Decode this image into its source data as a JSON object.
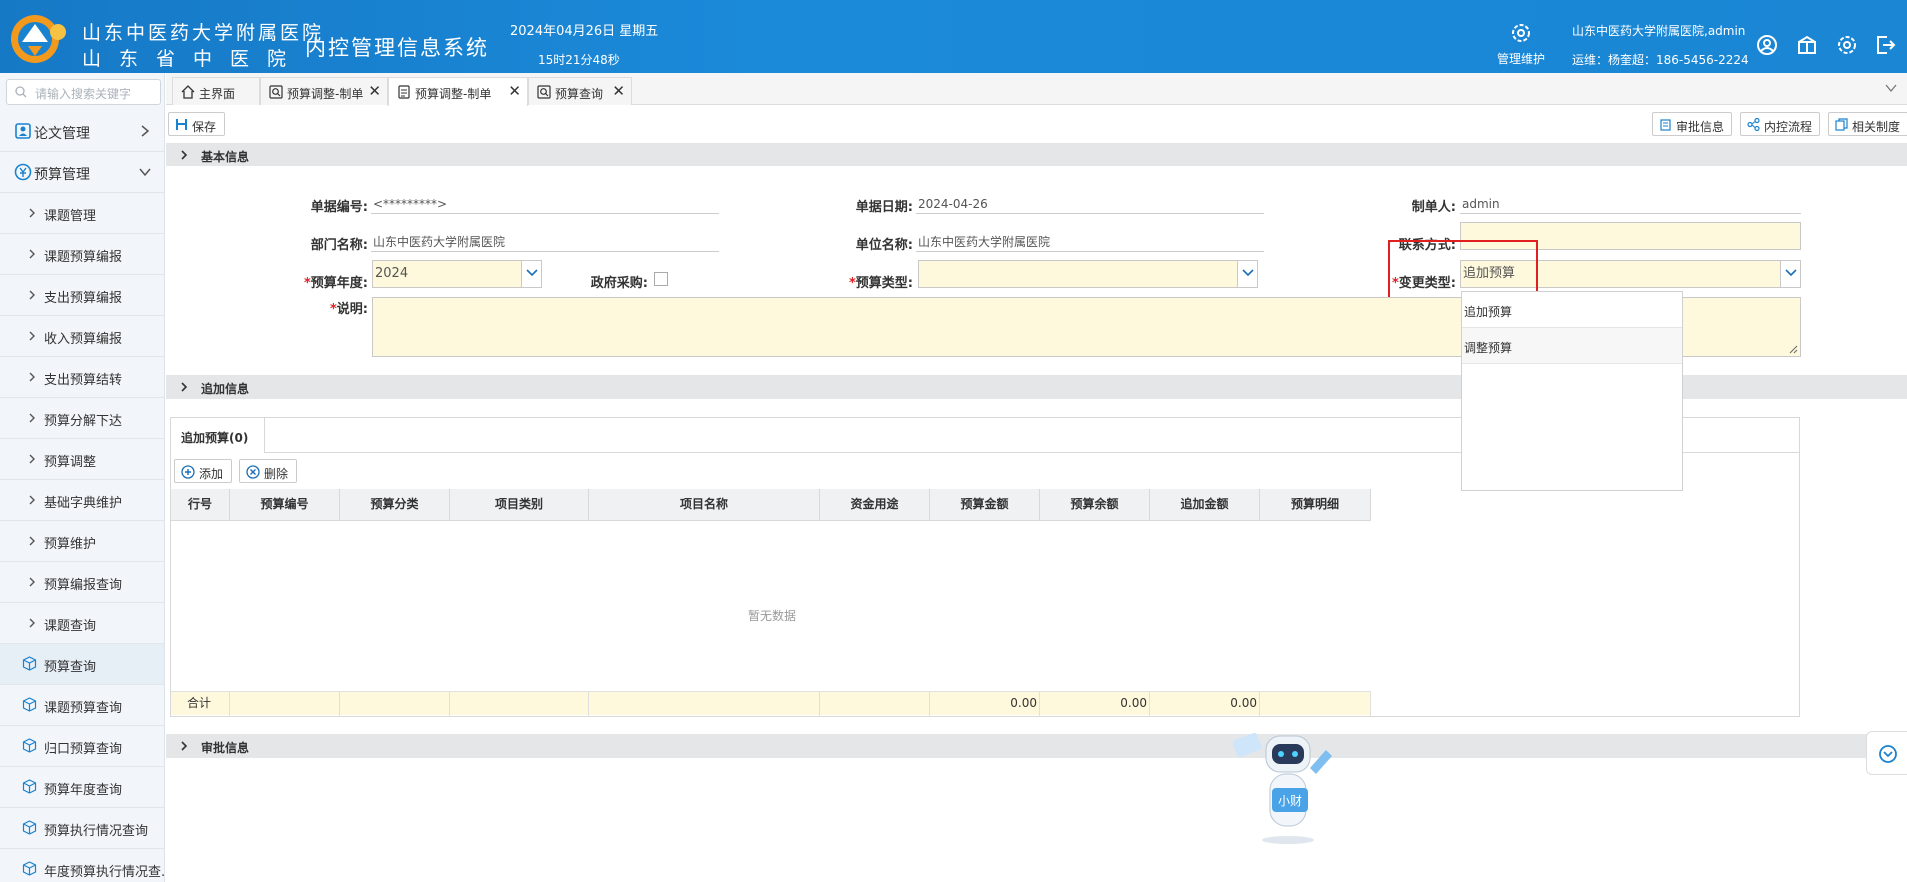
{
  "header": {
    "hospital_line1": "山东中医药大学附属医院",
    "hospital_line2": "山东省中医院",
    "system_name": "内控管理信息系统",
    "date": "2024年04月26日 星期五",
    "time": "15时21分48秒",
    "manage_label": "管理维护",
    "user": "山东中医药大学附属医院,admin",
    "ops": "运维：杨奎超：186-5456-2224",
    "icons": [
      "user-circle-icon",
      "gift-icon",
      "settings-icon",
      "logout-icon"
    ]
  },
  "sidebar": {
    "search_placeholder": "请输入搜索关键字",
    "items": [
      {
        "label": "论文管理",
        "kind": "top",
        "expanded": false
      },
      {
        "label": "预算管理",
        "kind": "top",
        "expanded": true
      },
      {
        "label": "课题管理",
        "kind": "sub"
      },
      {
        "label": "课题预算编报",
        "kind": "sub"
      },
      {
        "label": "支出预算编报",
        "kind": "sub"
      },
      {
        "label": "收入预算编报",
        "kind": "sub"
      },
      {
        "label": "支出预算结转",
        "kind": "sub"
      },
      {
        "label": "预算分解下达",
        "kind": "sub"
      },
      {
        "label": "预算调整",
        "kind": "sub"
      },
      {
        "label": "基础字典维护",
        "kind": "sub"
      },
      {
        "label": "预算维护",
        "kind": "sub"
      },
      {
        "label": "预算编报查询",
        "kind": "sub"
      },
      {
        "label": "课题查询",
        "kind": "sub"
      },
      {
        "label": "预算查询",
        "kind": "query",
        "active": true
      },
      {
        "label": "课题预算查询",
        "kind": "query"
      },
      {
        "label": "归口预算查询",
        "kind": "query"
      },
      {
        "label": "预算年度查询",
        "kind": "query"
      },
      {
        "label": "预算执行情况查询",
        "kind": "query"
      },
      {
        "label": "年度预算执行情况查...",
        "kind": "query"
      }
    ]
  },
  "tabs": [
    {
      "label": "主界面",
      "closable": false,
      "active": false
    },
    {
      "label": "预算调整-制单",
      "closable": true,
      "active": false
    },
    {
      "label": "预算调整-制单",
      "closable": true,
      "active": true
    },
    {
      "label": "预算查询",
      "closable": true,
      "active": false
    }
  ],
  "toolbar": {
    "save": "保存",
    "approval_info": "审批信息",
    "control_flow": "内控流程",
    "related_rules": "相关制度"
  },
  "sections": {
    "basic": "基本信息",
    "additional": "追加信息",
    "approval": "审批信息"
  },
  "form": {
    "doc_no_label": "单据编号:",
    "doc_no": "<*********>",
    "doc_date_label": "单据日期:",
    "doc_date": "2024-04-26",
    "creator_label": "制单人:",
    "creator": "admin",
    "dept_label": "部门名称:",
    "dept": "山东中医药大学附属医院",
    "unit_label": "单位名称:",
    "unit": "山东中医药大学附属医院",
    "contact_label": "联系方式:",
    "contact": "",
    "year_label": "预算年度:",
    "year": "2024",
    "gov_purchase_label": "政府采购:",
    "gov_purchase": false,
    "budget_type_label": "预算类型:",
    "budget_type": "",
    "change_type_label": "变更类型:",
    "change_type": "追加预算",
    "desc_label": "说明:",
    "desc": "",
    "required_mark": "*"
  },
  "change_type_options": [
    "追加预算",
    "调整预算"
  ],
  "grid": {
    "tab_label": "追加预算(0)",
    "add": "添加",
    "delete": "删除",
    "columns": [
      "行号",
      "预算编号",
      "预算分类",
      "项目类别",
      "项目名称",
      "资金用途",
      "预算金额",
      "预算余额",
      "追加金额",
      "预算明细"
    ],
    "empty_text": "暂无数据",
    "footer": [
      "合计",
      "",
      "",
      "",
      "",
      "",
      "0.00",
      "0.00",
      "0.00",
      ""
    ]
  },
  "assistant_label": "小财"
}
